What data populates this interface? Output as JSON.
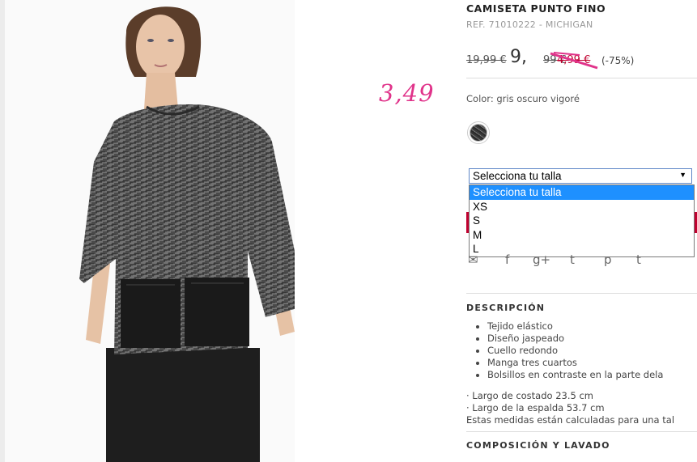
{
  "product": {
    "title": "CAMISETA PUNTO FINO",
    "ref": "REF. 71010222 - MICHIGAN",
    "price_original": "19,99 €",
    "price_mid_int": "9,",
    "price_mid_dec": "99 €",
    "price_sale": "4,99 €",
    "discount": "(-75%)",
    "color_label": "Color: gris oscuro vigoré"
  },
  "annotation": {
    "text": "3,49",
    "color": "#e0338a"
  },
  "size_select": {
    "value": "Selecciona tu talla",
    "options": [
      "Selecciona tu talla",
      "XS",
      "S",
      "M",
      "L"
    ],
    "highlighted_index": 0
  },
  "social_icons": [
    "email-icon",
    "facebook-icon",
    "google-plus-icon",
    "twitter-icon",
    "pinterest-icon",
    "tumblr-icon"
  ],
  "description": {
    "heading": "DESCRIPCIÓN",
    "bullets": [
      "Tejido elástico",
      "Diseño jaspeado",
      "Cuello redondo",
      "Manga tres cuartos",
      "Bolsillos en contraste en la parte dela"
    ],
    "measures": [
      "· Largo de costado 23.5 cm",
      "· Largo de la espalda 53.7 cm",
      "Estas medidas están calculadas para una tal"
    ]
  },
  "composition": {
    "heading": "COMPOSICIÓN Y LAVADO"
  },
  "colors": {
    "accent_red": "#c0002f",
    "select_highlight": "#1e90ff"
  }
}
